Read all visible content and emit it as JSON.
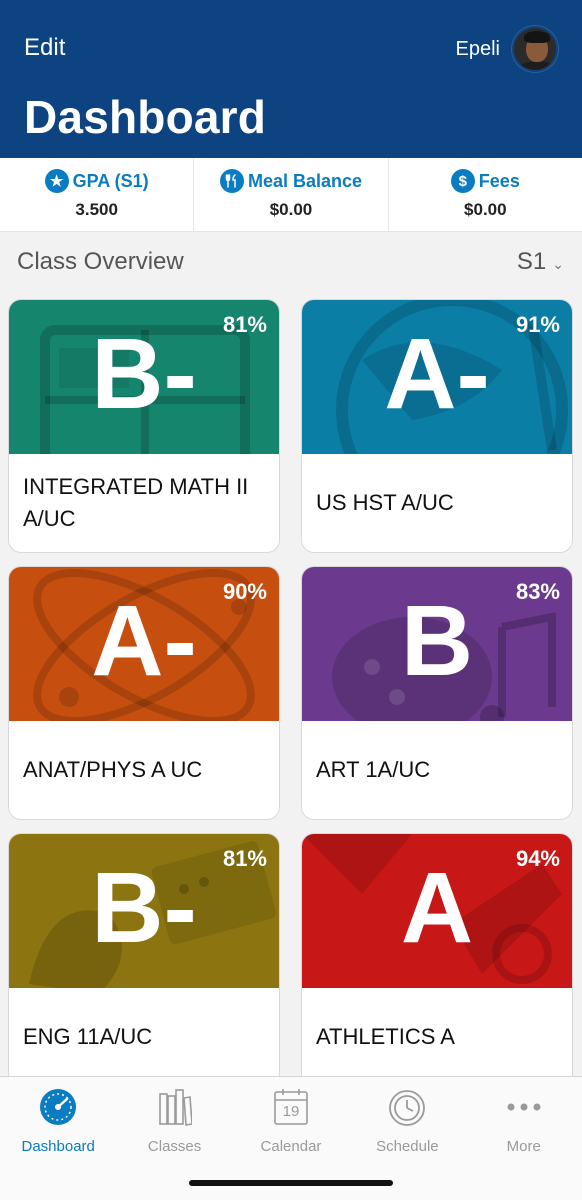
{
  "header": {
    "edit_label": "Edit",
    "user_name": "Epeli",
    "title": "Dashboard"
  },
  "stats": [
    {
      "label": "GPA (S1)",
      "value": "3.500",
      "icon": "star-icon"
    },
    {
      "label": "Meal Balance",
      "value": "$0.00",
      "icon": "utensils-icon"
    },
    {
      "label": "Fees",
      "value": "$0.00",
      "icon": "dollar-icon"
    }
  ],
  "section": {
    "title": "Class Overview",
    "term": "S1"
  },
  "classes": [
    {
      "grade": "B-",
      "percent": "81%",
      "name": "INTEGRATED MATH II A/UC",
      "color": "#16856e"
    },
    {
      "grade": "A-",
      "percent": "91%",
      "name": "US HST A/UC",
      "color": "#0b7ea6"
    },
    {
      "grade": "A-",
      "percent": "90%",
      "name": "ANAT/PHYS A UC",
      "color": "#c64f10"
    },
    {
      "grade": "B",
      "percent": "83%",
      "name": "ART 1A/UC",
      "color": "#6b3a8e"
    },
    {
      "grade": "B-",
      "percent": "81%",
      "name": "ENG 11A/UC",
      "color": "#8c7510"
    },
    {
      "grade": "A",
      "percent": "94%",
      "name": "ATHLETICS A",
      "color": "#c81717"
    }
  ],
  "tabs": [
    {
      "label": "Dashboard",
      "icon": "gauge-icon",
      "active": true
    },
    {
      "label": "Classes",
      "icon": "books-icon",
      "active": false
    },
    {
      "label": "Calendar",
      "icon": "calendar-icon",
      "calendar_day": "19",
      "active": false
    },
    {
      "label": "Schedule",
      "icon": "clock-icon",
      "active": false
    },
    {
      "label": "More",
      "icon": "ellipsis-icon",
      "active": false
    }
  ]
}
